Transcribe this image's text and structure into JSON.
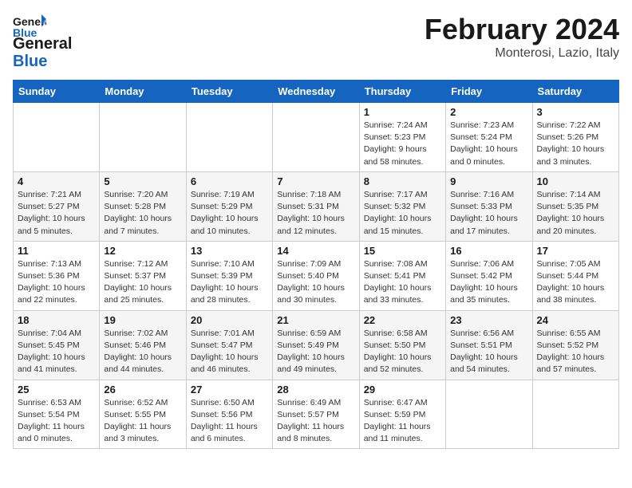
{
  "logo": {
    "general": "General",
    "blue": "Blue"
  },
  "title": {
    "month": "February 2024",
    "location": "Monterosi, Lazio, Italy"
  },
  "headers": [
    "Sunday",
    "Monday",
    "Tuesday",
    "Wednesday",
    "Thursday",
    "Friday",
    "Saturday"
  ],
  "weeks": [
    [
      {
        "day": "",
        "sunrise": "",
        "sunset": "",
        "daylight": ""
      },
      {
        "day": "",
        "sunrise": "",
        "sunset": "",
        "daylight": ""
      },
      {
        "day": "",
        "sunrise": "",
        "sunset": "",
        "daylight": ""
      },
      {
        "day": "",
        "sunrise": "",
        "sunset": "",
        "daylight": ""
      },
      {
        "day": "1",
        "sunrise": "Sunrise: 7:24 AM",
        "sunset": "Sunset: 5:23 PM",
        "daylight": "Daylight: 9 hours and 58 minutes."
      },
      {
        "day": "2",
        "sunrise": "Sunrise: 7:23 AM",
        "sunset": "Sunset: 5:24 PM",
        "daylight": "Daylight: 10 hours and 0 minutes."
      },
      {
        "day": "3",
        "sunrise": "Sunrise: 7:22 AM",
        "sunset": "Sunset: 5:26 PM",
        "daylight": "Daylight: 10 hours and 3 minutes."
      }
    ],
    [
      {
        "day": "4",
        "sunrise": "Sunrise: 7:21 AM",
        "sunset": "Sunset: 5:27 PM",
        "daylight": "Daylight: 10 hours and 5 minutes."
      },
      {
        "day": "5",
        "sunrise": "Sunrise: 7:20 AM",
        "sunset": "Sunset: 5:28 PM",
        "daylight": "Daylight: 10 hours and 7 minutes."
      },
      {
        "day": "6",
        "sunrise": "Sunrise: 7:19 AM",
        "sunset": "Sunset: 5:29 PM",
        "daylight": "Daylight: 10 hours and 10 minutes."
      },
      {
        "day": "7",
        "sunrise": "Sunrise: 7:18 AM",
        "sunset": "Sunset: 5:31 PM",
        "daylight": "Daylight: 10 hours and 12 minutes."
      },
      {
        "day": "8",
        "sunrise": "Sunrise: 7:17 AM",
        "sunset": "Sunset: 5:32 PM",
        "daylight": "Daylight: 10 hours and 15 minutes."
      },
      {
        "day": "9",
        "sunrise": "Sunrise: 7:16 AM",
        "sunset": "Sunset: 5:33 PM",
        "daylight": "Daylight: 10 hours and 17 minutes."
      },
      {
        "day": "10",
        "sunrise": "Sunrise: 7:14 AM",
        "sunset": "Sunset: 5:35 PM",
        "daylight": "Daylight: 10 hours and 20 minutes."
      }
    ],
    [
      {
        "day": "11",
        "sunrise": "Sunrise: 7:13 AM",
        "sunset": "Sunset: 5:36 PM",
        "daylight": "Daylight: 10 hours and 22 minutes."
      },
      {
        "day": "12",
        "sunrise": "Sunrise: 7:12 AM",
        "sunset": "Sunset: 5:37 PM",
        "daylight": "Daylight: 10 hours and 25 minutes."
      },
      {
        "day": "13",
        "sunrise": "Sunrise: 7:10 AM",
        "sunset": "Sunset: 5:39 PM",
        "daylight": "Daylight: 10 hours and 28 minutes."
      },
      {
        "day": "14",
        "sunrise": "Sunrise: 7:09 AM",
        "sunset": "Sunset: 5:40 PM",
        "daylight": "Daylight: 10 hours and 30 minutes."
      },
      {
        "day": "15",
        "sunrise": "Sunrise: 7:08 AM",
        "sunset": "Sunset: 5:41 PM",
        "daylight": "Daylight: 10 hours and 33 minutes."
      },
      {
        "day": "16",
        "sunrise": "Sunrise: 7:06 AM",
        "sunset": "Sunset: 5:42 PM",
        "daylight": "Daylight: 10 hours and 35 minutes."
      },
      {
        "day": "17",
        "sunrise": "Sunrise: 7:05 AM",
        "sunset": "Sunset: 5:44 PM",
        "daylight": "Daylight: 10 hours and 38 minutes."
      }
    ],
    [
      {
        "day": "18",
        "sunrise": "Sunrise: 7:04 AM",
        "sunset": "Sunset: 5:45 PM",
        "daylight": "Daylight: 10 hours and 41 minutes."
      },
      {
        "day": "19",
        "sunrise": "Sunrise: 7:02 AM",
        "sunset": "Sunset: 5:46 PM",
        "daylight": "Daylight: 10 hours and 44 minutes."
      },
      {
        "day": "20",
        "sunrise": "Sunrise: 7:01 AM",
        "sunset": "Sunset: 5:47 PM",
        "daylight": "Daylight: 10 hours and 46 minutes."
      },
      {
        "day": "21",
        "sunrise": "Sunrise: 6:59 AM",
        "sunset": "Sunset: 5:49 PM",
        "daylight": "Daylight: 10 hours and 49 minutes."
      },
      {
        "day": "22",
        "sunrise": "Sunrise: 6:58 AM",
        "sunset": "Sunset: 5:50 PM",
        "daylight": "Daylight: 10 hours and 52 minutes."
      },
      {
        "day": "23",
        "sunrise": "Sunrise: 6:56 AM",
        "sunset": "Sunset: 5:51 PM",
        "daylight": "Daylight: 10 hours and 54 minutes."
      },
      {
        "day": "24",
        "sunrise": "Sunrise: 6:55 AM",
        "sunset": "Sunset: 5:52 PM",
        "daylight": "Daylight: 10 hours and 57 minutes."
      }
    ],
    [
      {
        "day": "25",
        "sunrise": "Sunrise: 6:53 AM",
        "sunset": "Sunset: 5:54 PM",
        "daylight": "Daylight: 11 hours and 0 minutes."
      },
      {
        "day": "26",
        "sunrise": "Sunrise: 6:52 AM",
        "sunset": "Sunset: 5:55 PM",
        "daylight": "Daylight: 11 hours and 3 minutes."
      },
      {
        "day": "27",
        "sunrise": "Sunrise: 6:50 AM",
        "sunset": "Sunset: 5:56 PM",
        "daylight": "Daylight: 11 hours and 6 minutes."
      },
      {
        "day": "28",
        "sunrise": "Sunrise: 6:49 AM",
        "sunset": "Sunset: 5:57 PM",
        "daylight": "Daylight: 11 hours and 8 minutes."
      },
      {
        "day": "29",
        "sunrise": "Sunrise: 6:47 AM",
        "sunset": "Sunset: 5:59 PM",
        "daylight": "Daylight: 11 hours and 11 minutes."
      },
      {
        "day": "",
        "sunrise": "",
        "sunset": "",
        "daylight": ""
      },
      {
        "day": "",
        "sunrise": "",
        "sunset": "",
        "daylight": ""
      }
    ]
  ]
}
